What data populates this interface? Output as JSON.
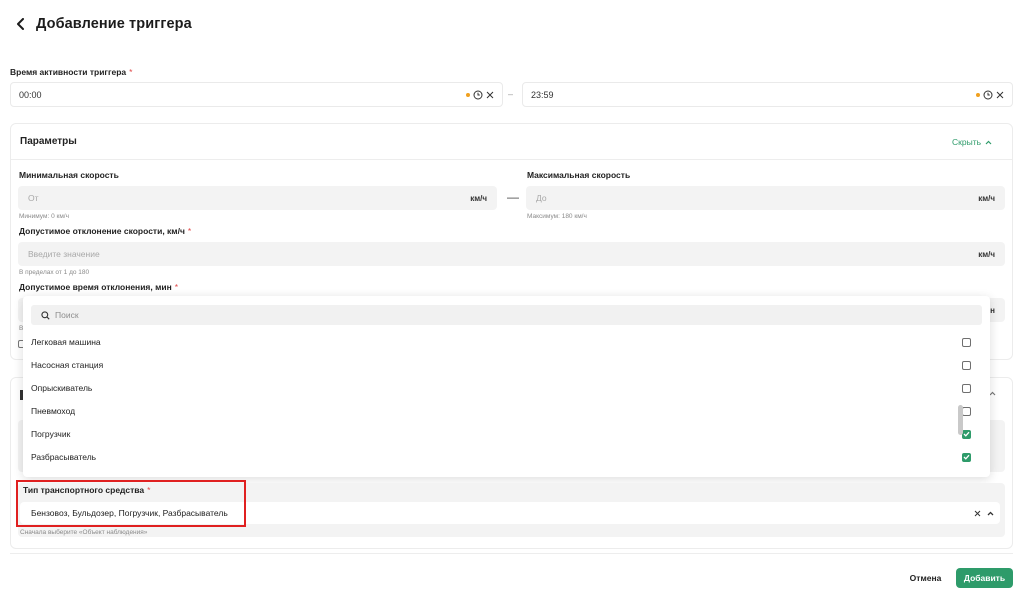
{
  "header": {
    "title": "Добавление триггера"
  },
  "activity_time": {
    "label": "Время активности триггера",
    "required_mark": "*",
    "start": "00:00",
    "end": "23:59",
    "range_dash": "–"
  },
  "params": {
    "title": "Параметры",
    "toggle_label": "Скрыть",
    "min_speed": {
      "label": "Минимальная скорость",
      "placeholder": "От",
      "unit": "км/ч",
      "hint": "Минимум: 0 км/ч"
    },
    "max_speed": {
      "label": "Максимальная скорость",
      "placeholder": "До",
      "unit": "км/ч",
      "hint": "Максимум: 180 км/ч"
    },
    "speed_dash": "—",
    "deviation": {
      "label": "Допустимое отклонение скорости, км/ч",
      "required_mark": "*",
      "placeholder": "Введите значение",
      "unit": "км/ч",
      "hint": "В пределах от 1 до 180"
    },
    "deviation_time": {
      "label": "Допустимое время отклонения, мин",
      "required_mark": "*",
      "unit_partial": "ин",
      "hint_partial": "В"
    }
  },
  "dropdown": {
    "search_placeholder": "Поиск",
    "items": [
      {
        "label": "Легковая машина",
        "checked": false
      },
      {
        "label": "Насосная станция",
        "checked": false
      },
      {
        "label": "Опрыскиватель",
        "checked": false
      },
      {
        "label": "Пневмоход",
        "checked": false
      },
      {
        "label": "Погрузчик",
        "checked": true
      },
      {
        "label": "Разбрасыватель",
        "checked": true
      }
    ]
  },
  "vehicle_type": {
    "label": "Тип транспортного средства",
    "required_mark": "*",
    "value": "Бензовоз, Бульдозер, Погрузчик, Разбрасыватель",
    "hint": "Сначала выберите «Объект наблюдения»"
  },
  "footer": {
    "cancel": "Отмена",
    "add": "Добавить"
  },
  "colors": {
    "accent": "#2e9b6a",
    "required": "#e04848",
    "highlight": "#e02020",
    "clock_dot": "#f0a01e"
  }
}
